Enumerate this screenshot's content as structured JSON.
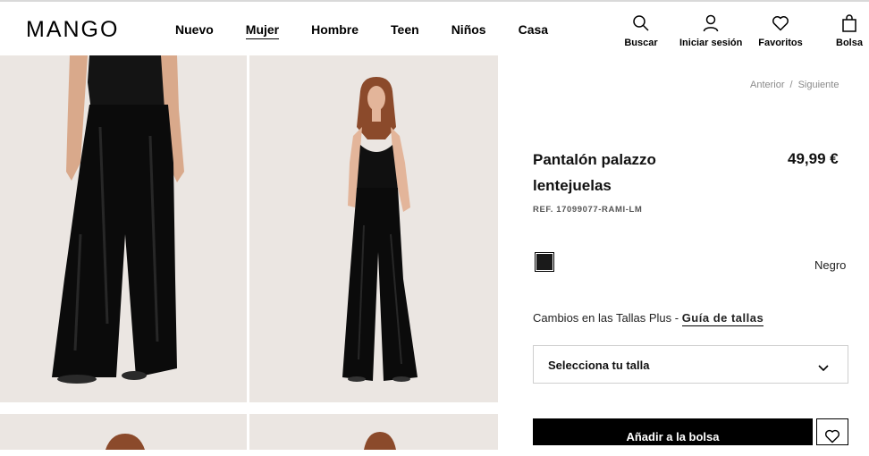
{
  "brand": {
    "logo": "MANGO"
  },
  "nav": {
    "items": [
      "Nuevo",
      "Mujer",
      "Hombre",
      "Teen",
      "Niños",
      "Casa"
    ],
    "active": "Mujer"
  },
  "header_actions": {
    "search": "Buscar",
    "login": "Iniciar sesión",
    "favorites": "Favoritos",
    "bag": "Bolsa"
  },
  "breadcrumb": {
    "previous": "Anterior",
    "separator": "/",
    "next": "Siguiente"
  },
  "product": {
    "name": "Pantalón palazzo lentejuelas",
    "price": "49,99 €",
    "ref": "REF. 17099077-RAMI-LM",
    "color_name": "Negro",
    "size_change_text": "Cambios en las Tallas Plus -",
    "size_guide_link": "Guía de tallas",
    "size_select_placeholder": "Selecciona tu talla",
    "add_to_bag": "Añadir a la bolsa"
  },
  "colors": {
    "swatch": "#1a1a1a",
    "photo_bg": "#ebe6e2",
    "crumb_text": "#8a8a8a"
  },
  "icons": [
    "search-icon",
    "user-icon",
    "heart-icon",
    "bag-icon",
    "chevron-down-icon"
  ]
}
